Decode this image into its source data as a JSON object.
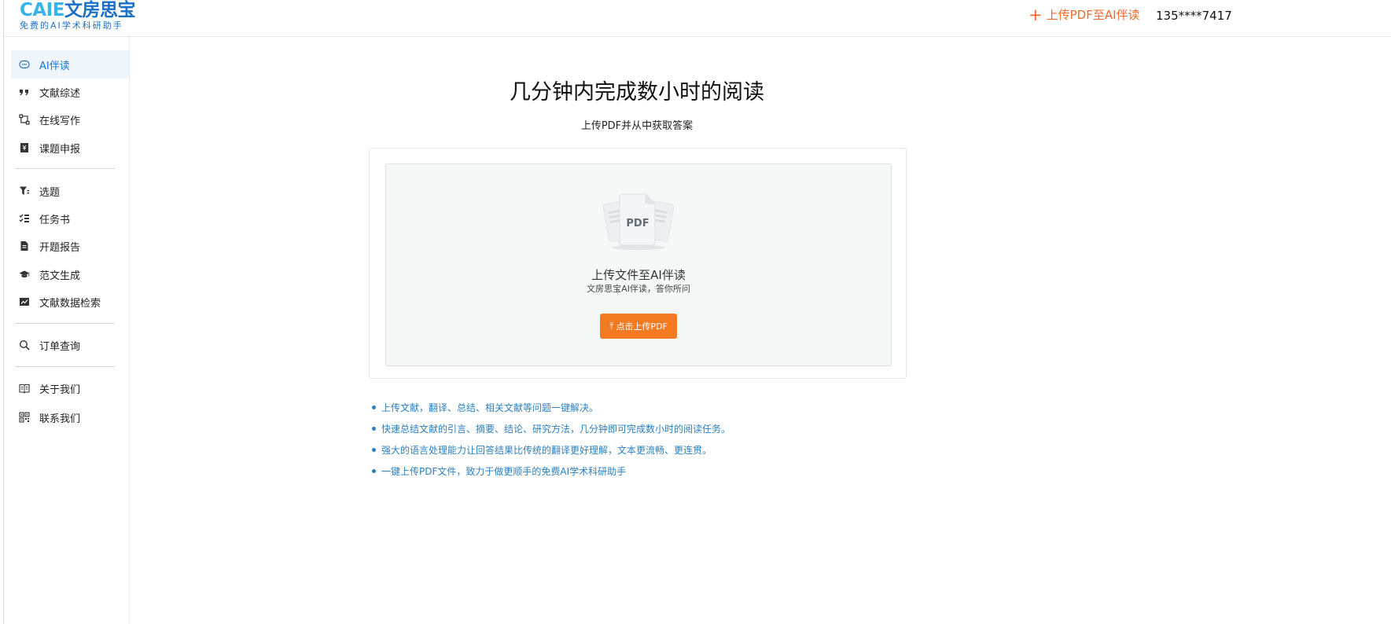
{
  "header": {
    "logo_en": "CAIE",
    "logo_cn": "文房思宝",
    "logo_tagline": "免费的AI学术科研助手",
    "upload_plus": "+",
    "upload_label": "上传PDF至AI伴读",
    "user_phone": "135****7417"
  },
  "sidebar": {
    "items": [
      {
        "label": "AI伴读",
        "icon": "chat-bubble-icon",
        "active": true
      },
      {
        "label": "文献综述",
        "icon": "quote-icon"
      },
      {
        "label": "在线写作",
        "icon": "flow-icon"
      },
      {
        "label": "课题申报",
        "icon": "bookmark-icon"
      },
      {
        "label": "选题",
        "icon": "filter-icon"
      },
      {
        "label": "任务书",
        "icon": "tasklist-icon"
      },
      {
        "label": "开题报告",
        "icon": "report-icon"
      },
      {
        "label": "范文生成",
        "icon": "graduation-cap-icon"
      },
      {
        "label": "文献数据检索",
        "icon": "chart-image-icon"
      },
      {
        "label": "订单查询",
        "icon": "search-icon"
      },
      {
        "label": "关于我们",
        "icon": "book-open-icon"
      },
      {
        "label": "联系我们",
        "icon": "qrcode-icon"
      }
    ]
  },
  "main": {
    "title": "几分钟内完成数小时的阅读",
    "subtitle": "上传PDF并从中获取答案",
    "dropzone": {
      "pdf_label": "PDF",
      "title": "上传文件至AI伴读",
      "subtitle": "文房思宝AI伴读，答你所问",
      "button_arrow": "⤒",
      "button_label": "点击上传PDF"
    },
    "features": [
      "上传文献，翻译、总结、相关文献等问题一键解决。",
      "快速总结文献的引言、摘要、结论、研究方法，几分钟即可完成数小时的阅读任务。",
      "强大的语言处理能力让回答结果比传统的翻译更好理解，文本更流畅、更连贯。",
      "一键上传PDF文件，致力于做更顺手的免费AI学术科研助手"
    ]
  },
  "colors": {
    "accent_orange": "#f47a22",
    "link_blue": "#2a7fc1",
    "logo_blue": "#1a6fc6",
    "logo_light_blue": "#39b4ea"
  }
}
